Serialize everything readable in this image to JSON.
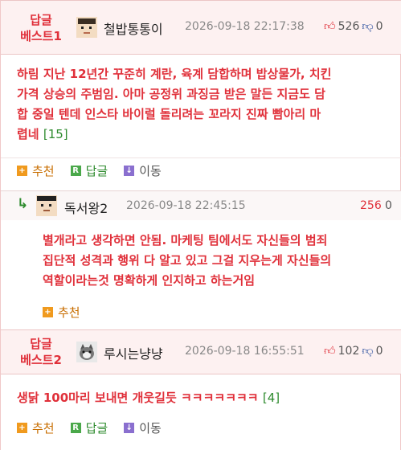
{
  "comments": [
    {
      "badge_line1": "답글",
      "badge_line2": "베스트1",
      "nickname": "철밥통통이",
      "date": "2026-09-18 22:17:38",
      "up": "526",
      "down": "0",
      "text_lines": [
        "하림 지난 12년간 꾸준히 계란, 육계 담합하며 밥상물가, 치킨",
        "가격 상승의 주범임. 아마 공정위 과징금 받은 말든 지금도 담",
        "합 중일 텐데 인스타 바이럴 돌리려는 꼬라지 진짜 빰아리 마",
        "렵네"
      ],
      "reply_count": "[15]"
    },
    {
      "badge_line1": "답글",
      "badge_line2": "베스트2",
      "nickname": "루시는냥냥",
      "date": "2026-09-18 16:55:51",
      "up": "102",
      "down": "0",
      "text_lines": [
        "생닭 100마리 보내면 개웃길듯 ㅋㅋㅋㅋㅋㅋㅋ"
      ],
      "reply_count": "[4]"
    }
  ],
  "reply": {
    "arrow": "↳",
    "nickname": "독서왕2",
    "date": "2026-09-18 22:45:15",
    "score": "256",
    "x_mark": "0",
    "text_lines": [
      "별개라고 생각하면 안됨. 마케팅 팀에서도 자신들의 범죄",
      "집단적 성격과 행위 다 알고 있고 그걸 지우는게 자신들의",
      "역할이라는것 명확하게 인지하고 하는거임"
    ],
    "recommend": "추천"
  },
  "actions": {
    "recommend": "추천",
    "reply": "답글",
    "move": "이동",
    "recommend_icon": "+",
    "reply_icon": "R",
    "move_icon": "↓"
  },
  "colors": {
    "accent_red": "#e0303a",
    "count_green": "#2e8b2e",
    "header_bg": "#fdf1f1"
  }
}
